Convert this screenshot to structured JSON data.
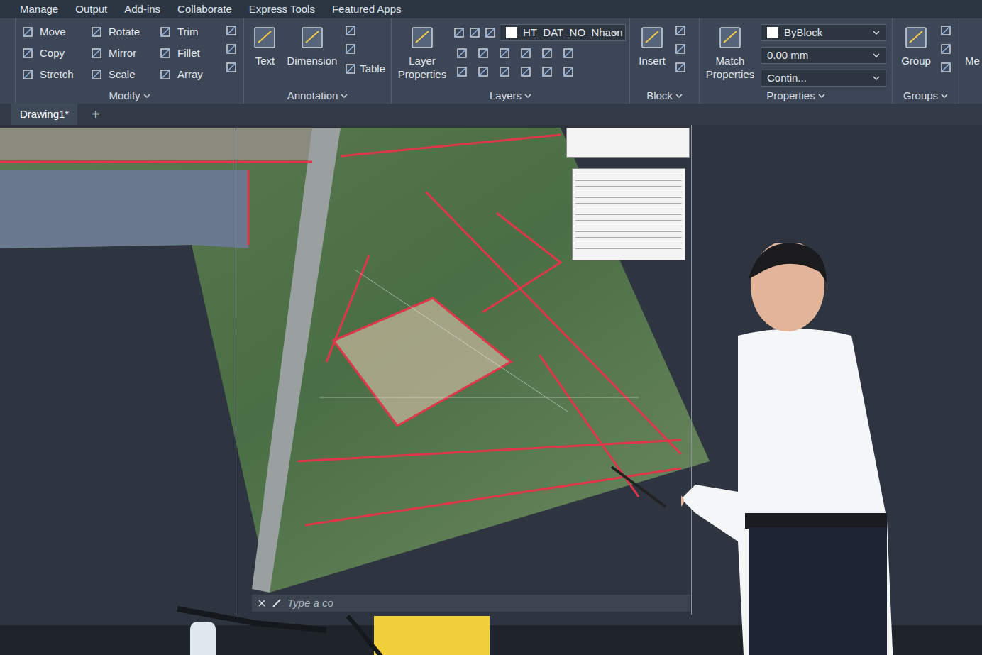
{
  "menu": [
    "Manage",
    "Output",
    "Add-ins",
    "Collaborate",
    "Express Tools",
    "Featured Apps"
  ],
  "ribbon": {
    "modify": {
      "title": "Modify",
      "tools": [
        "Move",
        "Rotate",
        "Trim",
        "Copy",
        "Mirror",
        "Fillet",
        "Stretch",
        "Scale",
        "Array"
      ]
    },
    "annotation": {
      "title": "Annotation",
      "big": [
        "Text",
        "Dimension"
      ],
      "small": "Table"
    },
    "layers": {
      "title": "Layers",
      "big": "Layer Properties",
      "layer": "HT_DAT_NO_Nhaon"
    },
    "block": {
      "title": "Block",
      "big": "Insert"
    },
    "properties": {
      "title": "Properties",
      "big": "Match Properties",
      "color": "ByBlock",
      "lineweight": "0.00 mm",
      "linetype": "Contin..."
    },
    "groups": {
      "title": "Groups",
      "big": "Group"
    },
    "overflow": "Me"
  },
  "document_tabs": [
    {
      "label": "Drawing1*",
      "selected": true
    }
  ],
  "new_tab": "+",
  "layout_add": "+",
  "command_line": {
    "placeholder": "Type a co"
  }
}
